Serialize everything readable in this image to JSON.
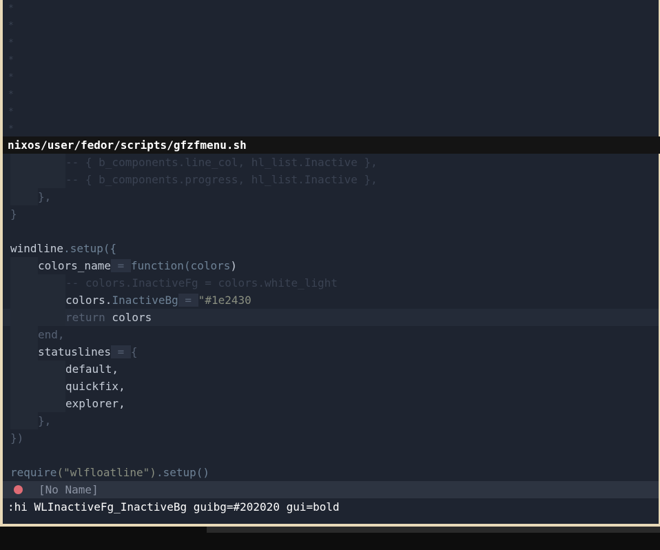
{
  "empty_line_marker": "*",
  "empty_lines_count_visible": 8,
  "winbar": {
    "file_path": "nixos/user/fedor/scripts/gfzfmenu.sh"
  },
  "code": {
    "l1": "-- { b_components.line_col, hl_list.Inactive },",
    "l2": "-- { b_components.progress, hl_list.Inactive },",
    "l3": "},",
    "l4": "}",
    "l5_a": "windline",
    "l5_b": ".setup({",
    "l6_a": "colors_name",
    "l6_b": " = ",
    "l6_c": "function(",
    "l6_d": "colors",
    "l6_e": ")",
    "l7": "-- colors.InactiveFg = colors.white_light",
    "l8_a": "colors.",
    "l8_b": "InactiveBg",
    "l8_c": " = ",
    "l8_d": "\"",
    "l8_e": "#1e2430",
    "l9_a": "return",
    "l9_b": " colors",
    "l10": "end,",
    "l11_a": "statuslines",
    "l11_b": " = ",
    "l11_c": "{",
    "l12": "default,",
    "l13": "quickfix,",
    "l14": "explorer,",
    "l15": "},",
    "l16": "})",
    "l17_a": "require",
    "l17_b": "(\"wlfloatline\")",
    "l17_c": ".setup()"
  },
  "statusline": {
    "buffer_name": "[No Name]"
  },
  "cmdline": {
    "text": ":hi WLInactiveFg_InactiveBg guibg=#202020 gui=bold"
  },
  "colors": {
    "background": "#1e2430",
    "winbar_bg": "#141414",
    "statusline_bg": "#2d3441",
    "status_dot": "#e06c75",
    "frame_border": "#e8d9b8"
  }
}
